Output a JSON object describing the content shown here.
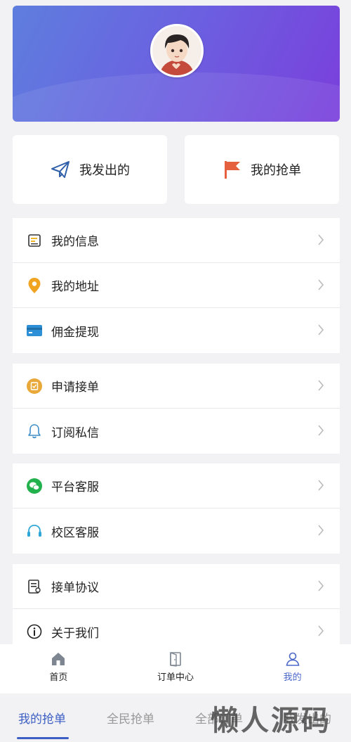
{
  "quick": {
    "sent_label": "我发出的",
    "grab_label": "我的抢单"
  },
  "menu": {
    "group1": [
      {
        "label": "我的信息",
        "icon": "info-card-icon"
      },
      {
        "label": "我的地址",
        "icon": "location-pin-icon"
      },
      {
        "label": "佣金提现",
        "icon": "wallet-card-icon"
      }
    ],
    "group2": [
      {
        "label": "申请接单",
        "icon": "apply-badge-icon"
      },
      {
        "label": "订阅私信",
        "icon": "bell-icon"
      }
    ],
    "group3": [
      {
        "label": "平台客服",
        "icon": "wechat-icon"
      },
      {
        "label": "校区客服",
        "icon": "headset-icon"
      }
    ],
    "group4": [
      {
        "label": "接单协议",
        "icon": "agreement-doc-icon"
      },
      {
        "label": "关于我们",
        "icon": "info-circle-icon"
      }
    ]
  },
  "tabbar": {
    "home": "首页",
    "orders": "订单中心",
    "mine": "我的"
  },
  "subtabs": {
    "my_grab": "我的抢单",
    "all_grab": "全民抢单",
    "all_orders": "全部订单",
    "my_sent": "我发出的"
  },
  "watermark": "懒人源码",
  "colors": {
    "accent": "#4b68c8",
    "header_start": "#5e7ede",
    "header_end": "#7a3fdc"
  }
}
